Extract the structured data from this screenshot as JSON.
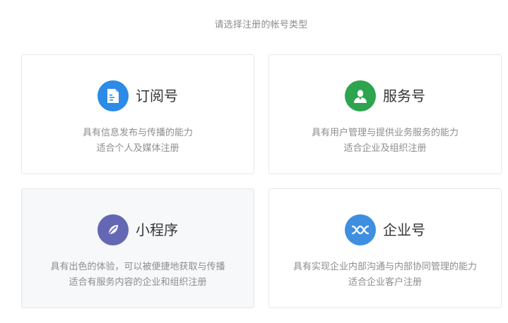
{
  "header": {
    "title": "请选择注册的帐号类型"
  },
  "cards": [
    {
      "name": "订阅号",
      "icon": "subscription-doc-icon",
      "icon_color": "#2b8be6",
      "desc_line1": "具有信息发布与传播的能力",
      "desc_line2": "适合个人及媒体注册"
    },
    {
      "name": "服务号",
      "icon": "service-person-icon",
      "icon_color": "#2da44e",
      "desc_line1": "具有用户管理与提供业务服务的能力",
      "desc_line2": "适合企业及组织注册"
    },
    {
      "name": "小程序",
      "icon": "mini-program-leaf-icon",
      "icon_color": "#6467b4",
      "desc_line1": "具有出色的体验，可以被便捷地获取与传播",
      "desc_line2": "适合有服务内容的企业和组织注册"
    },
    {
      "name": "企业号",
      "icon": "enterprise-link-icon",
      "icon_color": "#3f8fe0",
      "desc_line1": "具有实现企业内部沟通与内部协同管理的能力",
      "desc_line2": "适合企业客户注册"
    }
  ]
}
